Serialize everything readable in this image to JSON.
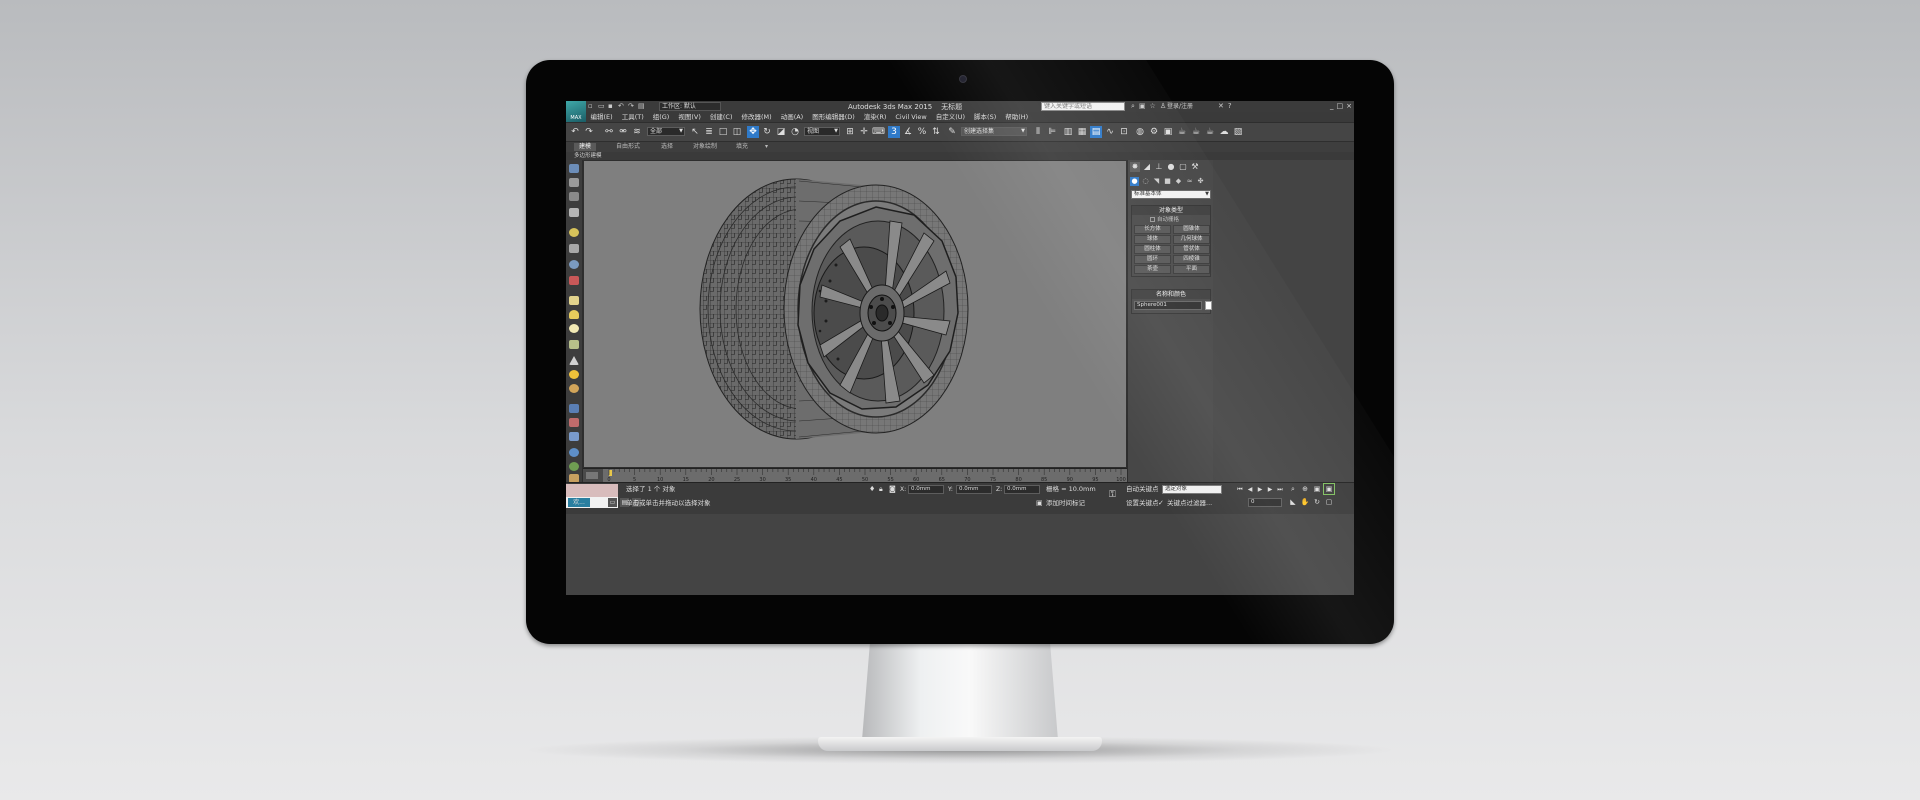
{
  "window": {
    "app_logo": "MAX",
    "title": "Autodesk 3ds Max 2015",
    "document": "无标题",
    "workspace": "工作区: 默认",
    "search_placeholder": "键入关键字或短语",
    "signin": "登录/注册",
    "controls": [
      "_",
      "□",
      "×"
    ]
  },
  "menu": {
    "items": [
      "编辑(E)",
      "工具(T)",
      "组(G)",
      "视图(V)",
      "创建(C)",
      "修改器(M)",
      "动画(A)",
      "图形编辑器(D)",
      "渲染(R)",
      "Civil View",
      "自定义(U)",
      "脚本(S)",
      "帮助(H)"
    ]
  },
  "toolbar": {
    "selection_filter": "全部",
    "reference_coord": "视图",
    "named_selection": "创建选择集"
  },
  "ribbon": {
    "tabs": [
      "建模",
      "自由形式",
      "选择",
      "对象绘制",
      "填充"
    ],
    "active_tab": "建模",
    "subtitle": "多边形建模"
  },
  "command_panel": {
    "category": "标准基本体",
    "object_type": {
      "header": "对象类型",
      "autogrid": "自动栅格",
      "buttons": [
        "长方体",
        "圆锥体",
        "球体",
        "几何球体",
        "圆柱体",
        "管状体",
        "圆环",
        "四棱锥",
        "茶壶",
        "平面"
      ]
    },
    "name_color": {
      "header": "名称和颜色",
      "name": "Sphere001",
      "color": "#ffffff"
    }
  },
  "timeline": {
    "ticks": [
      "0",
      "5",
      "10",
      "15",
      "20",
      "25",
      "30",
      "35",
      "40",
      "45",
      "50",
      "55",
      "60",
      "65",
      "70",
      "75",
      "80",
      "85",
      "90",
      "95",
      "100"
    ],
    "current_frame": "0 / 100"
  },
  "status": {
    "selection": "选择了 1 个 对象",
    "prompt": "单击或单击并拖动以选择对象",
    "x_label": "X:",
    "x_value": "0.0mm",
    "y_label": "Y:",
    "y_value": "0.0mm",
    "z_label": "Z:",
    "z_value": "0.0mm",
    "grid": "栅格 = 10.0mm",
    "add_time_tag": "添加时间标记",
    "auto_key": "自动关键点",
    "selected_object": "选定对象",
    "set_key": "设置关键点",
    "key_filters": "关键点过滤器...",
    "frame": "0",
    "taskbar_label": "欢..."
  },
  "colors": {
    "viewport_bg": "#7f7f7f",
    "accent_blue": "#2f7ac9",
    "maxscript_pink": "#d8bcbc"
  }
}
